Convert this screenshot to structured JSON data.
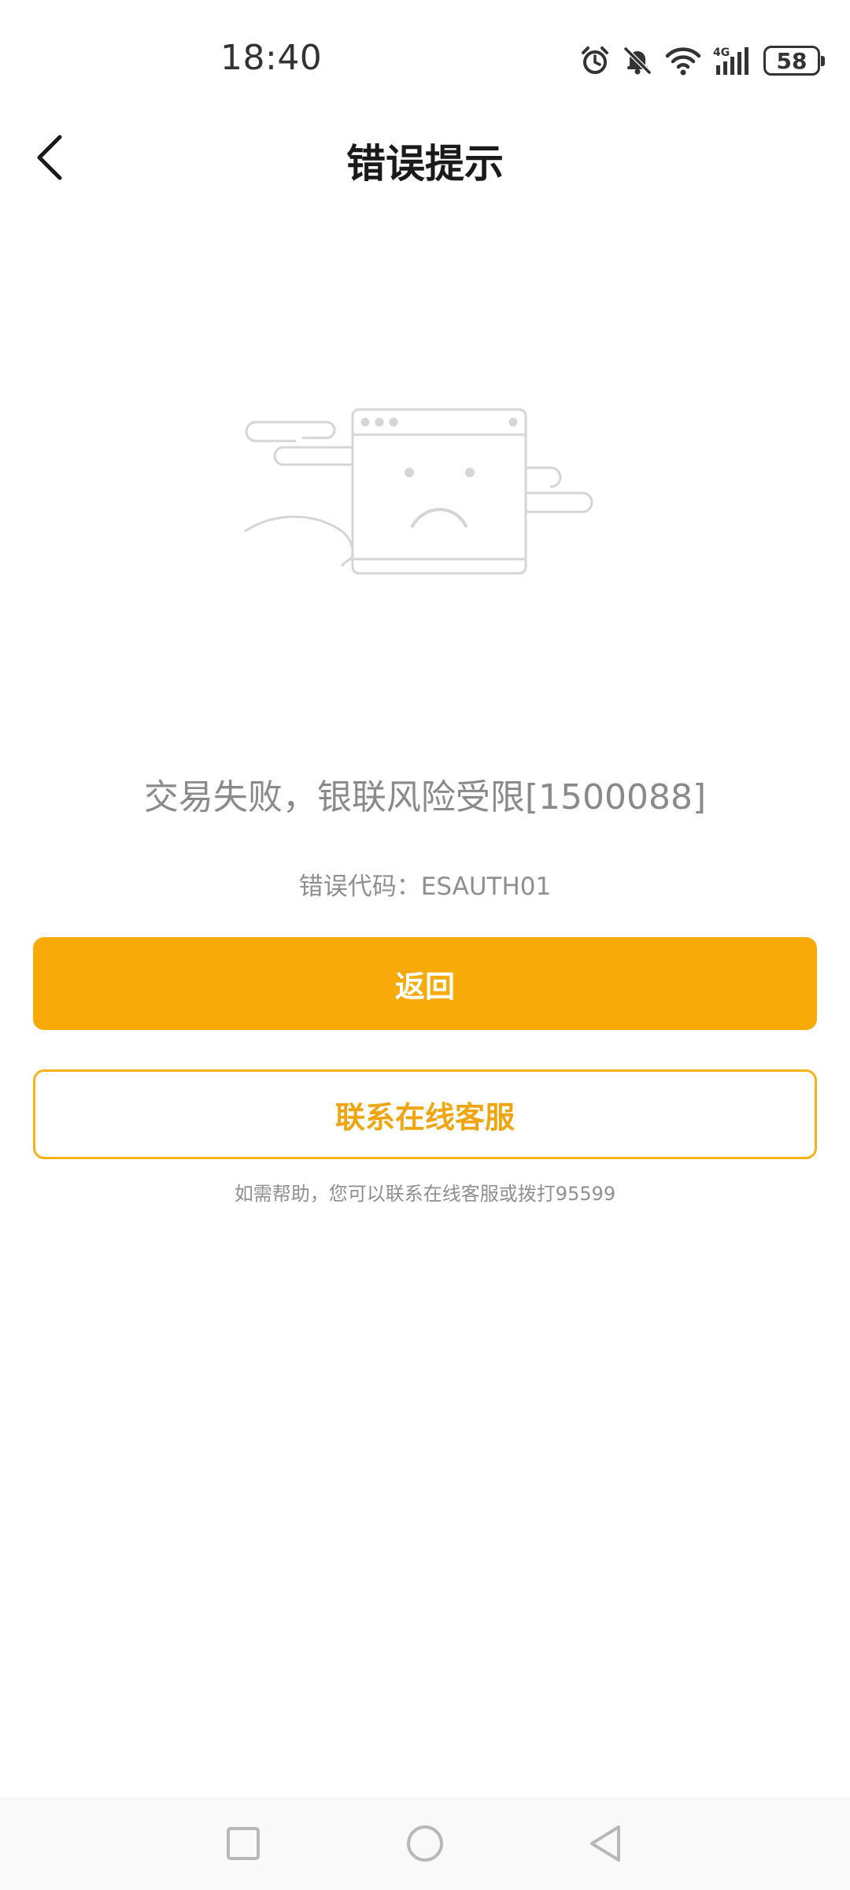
{
  "status_bar": {
    "time": "18:40",
    "battery": "58",
    "network": "4G",
    "icons": [
      "alarm-icon",
      "bell-off-icon",
      "wifi-icon",
      "signal-4g-icon",
      "battery-icon"
    ]
  },
  "header": {
    "title": "错误提示",
    "back_icon": "chevron-left-icon"
  },
  "illustration": {
    "icon": "sad-browser-window-illustration"
  },
  "error": {
    "message": "交易失败，银联风险受限[1500088]",
    "code_line": "错误代码：ESAUTH01"
  },
  "actions": {
    "primary_label": "返回",
    "secondary_label": "联系在线客服"
  },
  "help": {
    "text": "如需帮助，您可以联系在线客服或拨打95599"
  },
  "nav_bar": {
    "icons": [
      "recent-apps-icon",
      "home-icon",
      "back-triangle-icon"
    ]
  },
  "colors": {
    "accent": "#f8aa09",
    "accent_text": "#efa512",
    "text_gray": "#8a8a8a",
    "title": "#1a1a1a"
  }
}
